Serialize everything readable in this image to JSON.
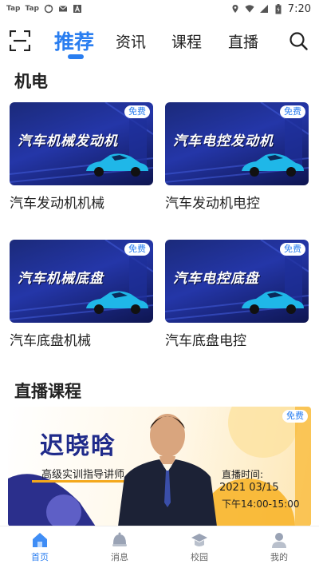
{
  "status_bar": {
    "left_items": [
      "Tap",
      "Tap"
    ],
    "time": "7:20"
  },
  "nav": {
    "tabs": [
      {
        "label": "推荐",
        "active": true
      },
      {
        "label": "资讯",
        "active": false
      },
      {
        "label": "课程",
        "active": false
      },
      {
        "label": "直播",
        "active": false
      }
    ],
    "scan_icon": "scan-icon",
    "search_icon": "search-icon"
  },
  "sections": [
    {
      "title": "机电",
      "cards": [
        {
          "thumb_title": "汽车机械发动机",
          "badge": "免费",
          "title": "汽车发动机机械"
        },
        {
          "thumb_title": "汽车电控发动机",
          "badge": "免费",
          "title": "汽车发动机电控"
        },
        {
          "thumb_title": "汽车机械底盘",
          "badge": "免费",
          "title": "汽车底盘机械"
        },
        {
          "thumb_title": "汽车电控底盘",
          "badge": "免费",
          "title": "汽车底盘电控"
        }
      ]
    },
    {
      "title": "直播课程",
      "live": {
        "name": "迟晓晗",
        "role": "高级实训指导讲师",
        "time_label": "直播时间:",
        "date": "2021 03/15",
        "hours": "下午14:00-15:00",
        "badge": "免费"
      }
    }
  ],
  "bottom_nav": [
    {
      "label": "首页",
      "icon": "home-icon",
      "active": true
    },
    {
      "label": "消息",
      "icon": "message-icon",
      "active": false
    },
    {
      "label": "校园",
      "icon": "campus-icon",
      "active": false
    },
    {
      "label": "我的",
      "icon": "profile-icon",
      "active": false
    }
  ],
  "colors": {
    "accent": "#2a7ef0",
    "thumb_bg": "#2436a8",
    "car": "#1fb7e8"
  }
}
